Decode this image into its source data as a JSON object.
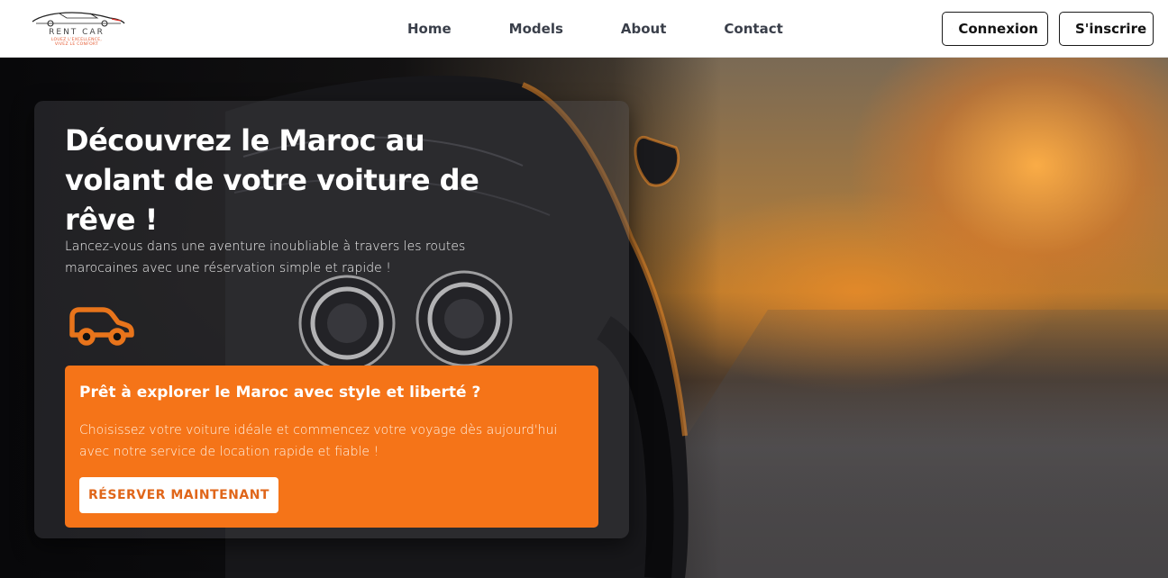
{
  "brand": {
    "name": "RENT CAR",
    "tagline_1": "LOUEZ L'EXCELLENCE,",
    "tagline_2": "VIVEZ LE CONFORT",
    "accent_color": "#f57418"
  },
  "nav": {
    "links": [
      {
        "label": "Home"
      },
      {
        "label": "Models"
      },
      {
        "label": "About"
      },
      {
        "label": "Contact"
      }
    ],
    "login": {
      "label": "Connexion",
      "icon": "user-circle-icon"
    },
    "signup": {
      "label": "S'inscrire",
      "icon": "user-plus-icon"
    }
  },
  "hero": {
    "title": "Découvrez le Maroc au volant de votre voiture de rêve !",
    "subtitle": "Lancez-vous dans une aventure inoubliable à travers les routes marocaines avec une réservation simple et rapide !",
    "icon": "car-icon",
    "cta": {
      "title": "Prêt à explorer le Maroc avec style et liberté ?",
      "text": "Choisissez votre voiture idéale et commencez votre voyage dès aujourd'hui avec notre service de location rapide et fiable !",
      "button_label": "RÉSERVER MAINTENANT",
      "background_color": "#f57418"
    }
  }
}
